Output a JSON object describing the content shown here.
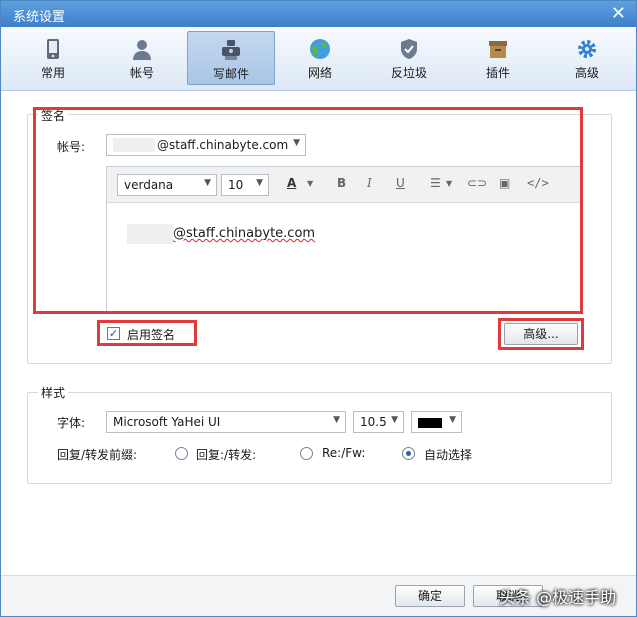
{
  "window": {
    "title": "系统设置"
  },
  "toolbar": {
    "items": [
      {
        "label": "常用",
        "icon": "phone-icon"
      },
      {
        "label": "帐号",
        "icon": "user-icon"
      },
      {
        "label": "写邮件",
        "icon": "compose-icon"
      },
      {
        "label": "网络",
        "icon": "globe-icon"
      },
      {
        "label": "反垃圾",
        "icon": "shield-icon"
      },
      {
        "label": "插件",
        "icon": "box-icon"
      },
      {
        "label": "高级",
        "icon": "gear-icon"
      }
    ],
    "active_index": 2
  },
  "signature": {
    "group_title": "签名",
    "account_label": "帐号:",
    "account_value": "@staff.chinabyte.com",
    "font_name": "verdana",
    "font_size": "10",
    "body_text": "@staff.chinabyte.com",
    "enable_label": "启用签名",
    "enable_checked": true,
    "advanced_button": "高级..."
  },
  "style": {
    "group_title": "样式",
    "font_label": "字体:",
    "font_value": "Microsoft YaHei UI",
    "size_value": "10.5",
    "reply_label": "回复/转发前缀:",
    "options": [
      "回复:/转发:",
      "Re:/Fw:",
      "自动选择"
    ],
    "selected_option": 2
  },
  "footer": {
    "ok_button": "确定",
    "cancel_button": "取消",
    "watermark": "头条 @极速手助"
  },
  "colors": {
    "highlight": "#e03a3a",
    "accent": "#3d7fc9"
  }
}
